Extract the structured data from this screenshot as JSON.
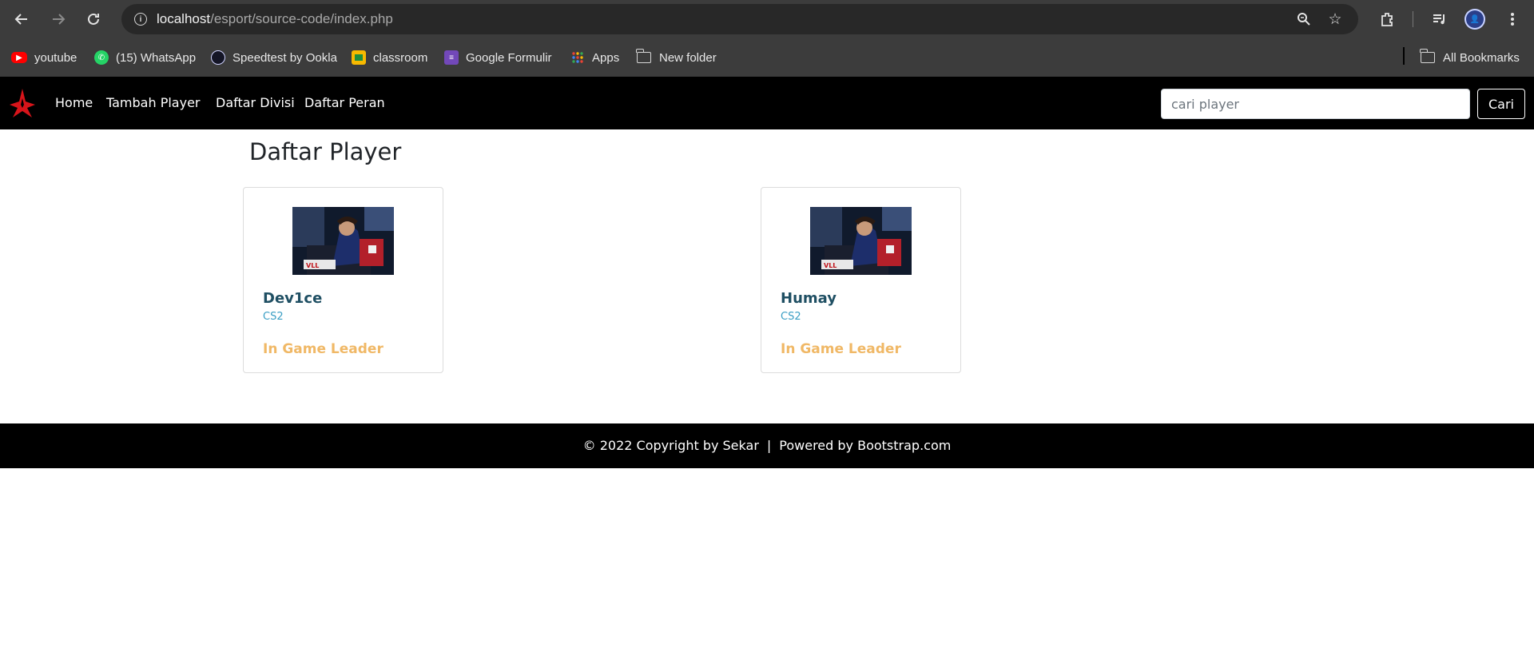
{
  "browser": {
    "url_host": "localhost",
    "url_path": "/esport/source-code/index.php",
    "profile_initials": "👤"
  },
  "bookmarks": [
    {
      "label": "youtube",
      "icon": "youtube-icon"
    },
    {
      "label": "(15) WhatsApp",
      "icon": "whatsapp-icon"
    },
    {
      "label": "Speedtest by Ookla",
      "icon": "speedtest-icon"
    },
    {
      "label": "classroom",
      "icon": "classroom-icon"
    },
    {
      "label": "Google Formulir",
      "icon": "google-forms-icon"
    },
    {
      "label": "Apps",
      "icon": "apps-grid-icon"
    },
    {
      "label": "New folder",
      "icon": "folder-icon"
    }
  ],
  "all_bookmarks_label": "All Bookmarks",
  "navbar": {
    "links": [
      "Home",
      "Tambah Player",
      "Daftar Divisi",
      "Daftar Peran"
    ],
    "search_placeholder": "cari player",
    "search_button": "Cari"
  },
  "page": {
    "title": "Daftar Player"
  },
  "players": [
    {
      "name": "Dev1ce",
      "game": "CS2",
      "role": "In Game Leader"
    },
    {
      "name": "Humay",
      "game": "CS2",
      "role": "In Game Leader"
    }
  ],
  "footer": {
    "copyright": "© 2022 Copyright by Sekar",
    "divider": "|",
    "powered": "Powered by Bootstrap.com"
  },
  "colors": {
    "navbar_bg": "#000000",
    "player_name": "#1f4f63",
    "game_label": "#3a9ec4",
    "role_label": "#f0b866",
    "brand_logo": "#d7141a"
  }
}
